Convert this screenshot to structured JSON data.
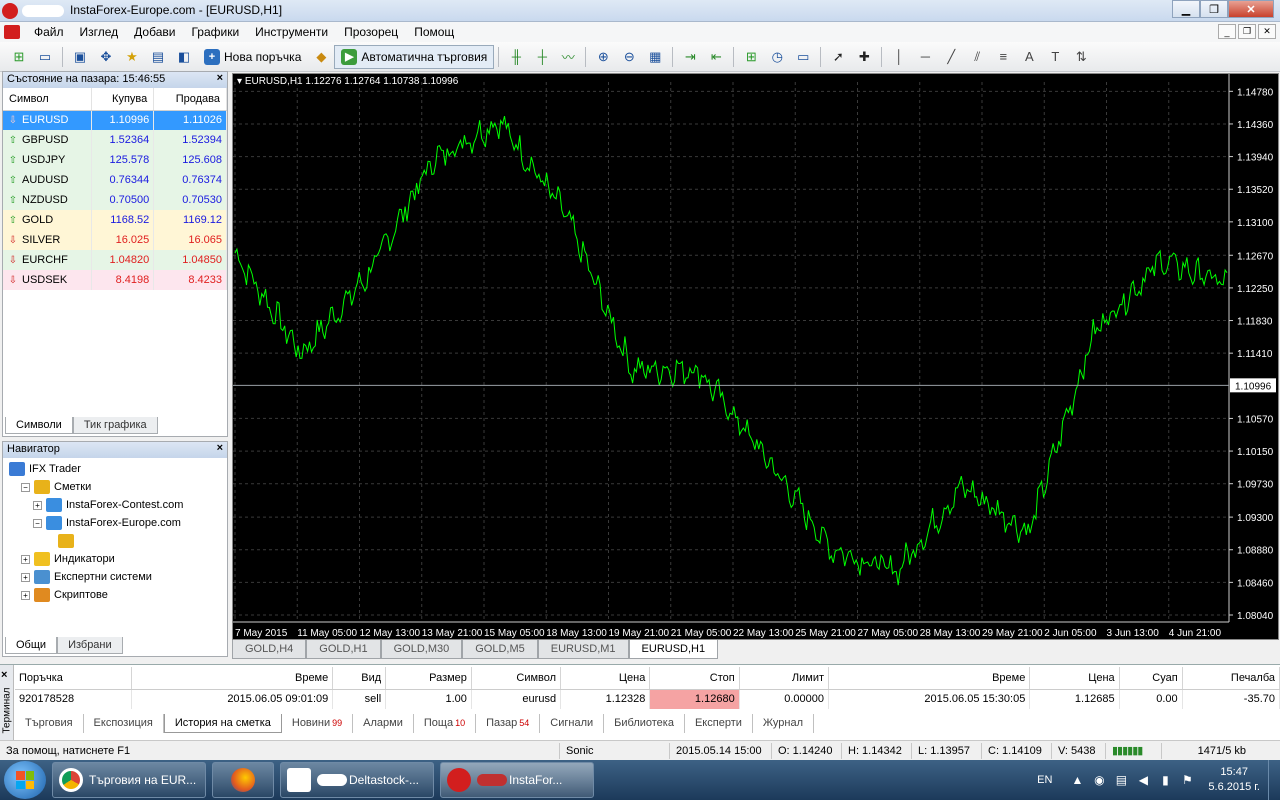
{
  "window": {
    "title": "InstaForex-Europe.com - [EURUSD,H1]"
  },
  "menu": [
    "Файл",
    "Изглед",
    "Добави",
    "Графики",
    "Инструменти",
    "Прозорец",
    "Помощ"
  ],
  "toolbar": {
    "new_order": "Нова поръчка",
    "auto_trading": "Автоматична търговия"
  },
  "market_watch": {
    "title": "Състояние на пазара: 15:46:55",
    "columns": [
      "Символ",
      "Купува",
      "Продава"
    ],
    "rows": [
      {
        "symbol": "EURUSD",
        "bid": "1.10996",
        "ask": "1.11026",
        "dir": "down",
        "bg": "#3399ff"
      },
      {
        "symbol": "GBPUSD",
        "bid": "1.52364",
        "ask": "1.52394",
        "dir": "up",
        "bg": "#e6f5e6"
      },
      {
        "symbol": "USDJPY",
        "bid": "125.578",
        "ask": "125.608",
        "dir": "up",
        "bg": "#e6f5e6"
      },
      {
        "symbol": "AUDUSD",
        "bid": "0.76344",
        "ask": "0.76374",
        "dir": "up",
        "bg": "#e6f5e6"
      },
      {
        "symbol": "NZDUSD",
        "bid": "0.70500",
        "ask": "0.70530",
        "dir": "up",
        "bg": "#e6f5e6"
      },
      {
        "symbol": "GOLD",
        "bid": "1168.52",
        "ask": "1169.12",
        "dir": "up",
        "bg": "#fff6d6"
      },
      {
        "symbol": "SILVER",
        "bid": "16.025",
        "ask": "16.065",
        "dir": "down",
        "bg": "#fff6d6"
      },
      {
        "symbol": "EURCHF",
        "bid": "1.04820",
        "ask": "1.04850",
        "dir": "down",
        "bg": "#e6f5e6"
      },
      {
        "symbol": "USDSEK",
        "bid": "8.4198",
        "ask": "8.4233",
        "dir": "down",
        "bg": "#fde6ee"
      }
    ],
    "tabs": [
      "Символи",
      "Тик графика"
    ]
  },
  "navigator": {
    "title": "Навигатор",
    "items": [
      {
        "label": "IFX Trader",
        "level": 0,
        "icon": "trader-icon"
      },
      {
        "label": "Сметки",
        "level": 1,
        "icon": "accounts-icon"
      },
      {
        "label": "InstaForex-Contest.com",
        "level": 2,
        "icon": "server-icon"
      },
      {
        "label": "InstaForex-Europe.com",
        "level": 2,
        "icon": "server-icon"
      },
      {
        "label": "",
        "level": 3,
        "icon": "account-user-icon"
      },
      {
        "label": "Индикатори",
        "level": 1,
        "icon": "indicators-icon"
      },
      {
        "label": "Експертни системи",
        "level": 1,
        "icon": "experts-icon"
      },
      {
        "label": "Скриптове",
        "level": 1,
        "icon": "scripts-icon"
      }
    ],
    "tabs": [
      "Общи",
      "Избрани"
    ]
  },
  "chart": {
    "header": "EURUSD,H1  1.12276 1.12764 1.10738 1.10996",
    "current_price": "1.10996",
    "price_labels": [
      "1.14780",
      "1.14360",
      "1.13940",
      "1.13520",
      "1.13100",
      "1.12670",
      "1.12250",
      "1.11830",
      "1.11410",
      "1.10570",
      "1.10150",
      "1.09730",
      "1.09300",
      "1.08880",
      "1.08460",
      "1.08040"
    ],
    "time_labels": [
      "7 May 2015",
      "11 May 05:00",
      "12 May 13:00",
      "13 May 21:00",
      "15 May 05:00",
      "18 May 13:00",
      "19 May 21:00",
      "21 May 05:00",
      "22 May 13:00",
      "25 May 21:00",
      "27 May 05:00",
      "28 May 13:00",
      "29 May 21:00",
      "2 Jun 05:00",
      "3 Jun 13:00",
      "4 Jun 21:00"
    ],
    "tabs": [
      "GOLD,H4",
      "GOLD,H1",
      "GOLD,M30",
      "GOLD,M5",
      "EURUSD,M1",
      "EURUSD,H1"
    ],
    "line_color": "#00ff00"
  },
  "chart_data": {
    "type": "line",
    "title": "EURUSD,H1",
    "ylim": [
      1.0795,
      1.149
    ],
    "x": [
      "7 May 2015",
      "11 May 05:00",
      "12 May 13:00",
      "13 May 21:00",
      "15 May 05:00",
      "18 May 13:00",
      "19 May 21:00",
      "21 May 05:00",
      "22 May 13:00",
      "25 May 21:00",
      "27 May 05:00",
      "28 May 13:00",
      "29 May 21:00",
      "2 Jun 05:00",
      "3 Jun 13:00",
      "4 Jun 21:00"
    ],
    "series": [
      {
        "values": [
          1.127,
          1.114,
          1.124,
          1.139,
          1.144,
          1.132,
          1.112,
          1.112,
          1.101,
          1.089,
          1.086,
          1.097,
          1.091,
          1.117,
          1.126,
          1.123
        ]
      }
    ]
  },
  "terminal": {
    "side_label": "Терминал",
    "columns": [
      "Поръчка",
      "Време",
      "Вид",
      "Размер",
      "Символ",
      "Цена",
      "Стоп",
      "Лимит",
      "Време",
      "Цена",
      "Суап",
      "Печалба"
    ],
    "row": [
      "920178528",
      "2015.06.05 09:01:09",
      "sell",
      "1.00",
      "eurusd",
      "1.12328",
      "1.12680",
      "0.00000",
      "2015.06.05 15:30:05",
      "1.12685",
      "0.00",
      "-35.70"
    ],
    "tabs": [
      {
        "label": "Търговия",
        "count": ""
      },
      {
        "label": "Експозиция",
        "count": ""
      },
      {
        "label": "История на сметка",
        "count": ""
      },
      {
        "label": "Новини",
        "count": "99"
      },
      {
        "label": "Аларми",
        "count": ""
      },
      {
        "label": "Поща",
        "count": "10"
      },
      {
        "label": "Пазар",
        "count": "54"
      },
      {
        "label": "Сигнали",
        "count": ""
      },
      {
        "label": "Библиотека",
        "count": ""
      },
      {
        "label": "Експерти",
        "count": ""
      },
      {
        "label": "Журнал",
        "count": ""
      }
    ]
  },
  "status": {
    "help": "За помощ, натиснете F1",
    "profile": "Sonic",
    "time": "2015.05.14 15:00",
    "open": "O: 1.14240",
    "high": "H: 1.14342",
    "low": "L: 1.13957",
    "close": "C: 1.14109",
    "volume": "V: 5438",
    "traffic": "1471/5 kb"
  },
  "taskbar": {
    "items": [
      "Търговия на EUR...",
      "",
      "Deltastock-...",
      "InstaFor..."
    ],
    "lang": "EN",
    "time": "15:47",
    "date": "5.6.2015 г."
  }
}
